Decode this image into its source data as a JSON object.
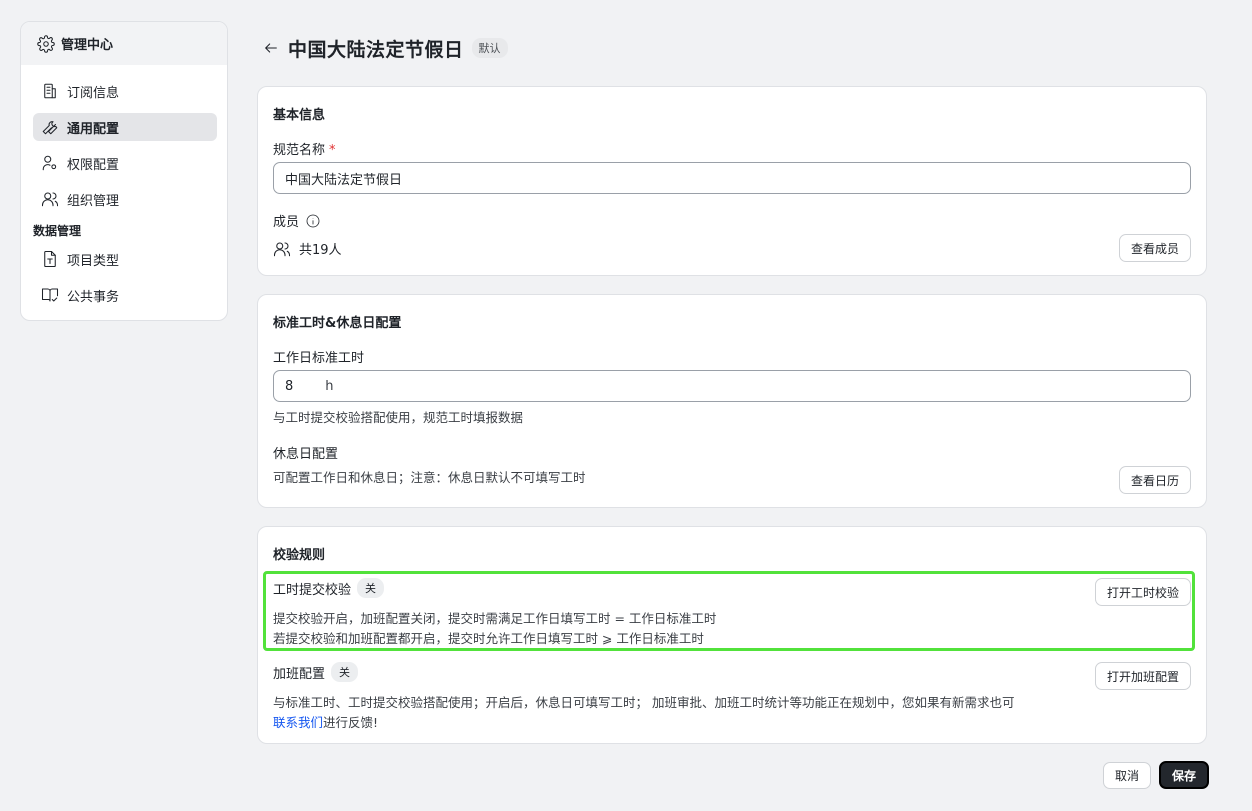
{
  "sidebar": {
    "header": "管理中心",
    "items": [
      {
        "label": "订阅信息",
        "icon": "building-icon"
      },
      {
        "label": "通用配置",
        "icon": "wrench-icon",
        "active": true
      },
      {
        "label": "权限配置",
        "icon": "user-gear-icon"
      },
      {
        "label": "组织管理",
        "icon": "users-icon"
      }
    ],
    "group_label": "数据管理",
    "group_items": [
      {
        "label": "项目类型",
        "icon": "doc-icon"
      },
      {
        "label": "公共事务",
        "icon": "book-check-icon"
      }
    ]
  },
  "page": {
    "title": "中国大陆法定节假日",
    "default_tag": "默认"
  },
  "basic": {
    "title": "基本信息",
    "name_label": "规范名称",
    "required_mark": "*",
    "name_value": "中国大陆法定节假日",
    "members_label": "成员",
    "members_count": "共19人",
    "view_members": "查看成员"
  },
  "workhours": {
    "title": "标准工时&休息日配置",
    "std_label": "工作日标准工时",
    "std_value": "8",
    "std_unit": "h",
    "std_hint": "与工时提交校验搭配使用，规范工时填报数据",
    "rest_label": "休息日配置",
    "rest_hint": "可配置工作日和休息日；注意：休息日默认不可填写工时",
    "view_calendar": "查看日历"
  },
  "rules": {
    "title": "校验规则",
    "submit_label": "工时提交校验",
    "submit_state": "关",
    "submit_btn": "打开工时校验",
    "submit_desc1": "提交校验开启，加班配置关闭，提交时需满足工作日填写工时 = 工作日标准工时",
    "submit_desc2": "若提交校验和加班配置都开启，提交时允许工作日填写工时 ⩾ 工作日标准工时",
    "ot_label": "加班配置",
    "ot_state": "关",
    "ot_btn": "打开加班配置",
    "ot_desc1": "与标准工时、工时提交校验搭配使用；开启后，休息日可填写工时； 加班审批、加班工时统计等功能正在规划中，您如果有新需求也可",
    "ot_link": "联系我们",
    "ot_desc2": "进行反馈!"
  },
  "footer": {
    "cancel": "取消",
    "save": "保存"
  },
  "colors": {
    "highlight": "#52e23b",
    "link": "#1456f0",
    "primary": "#23272d"
  }
}
